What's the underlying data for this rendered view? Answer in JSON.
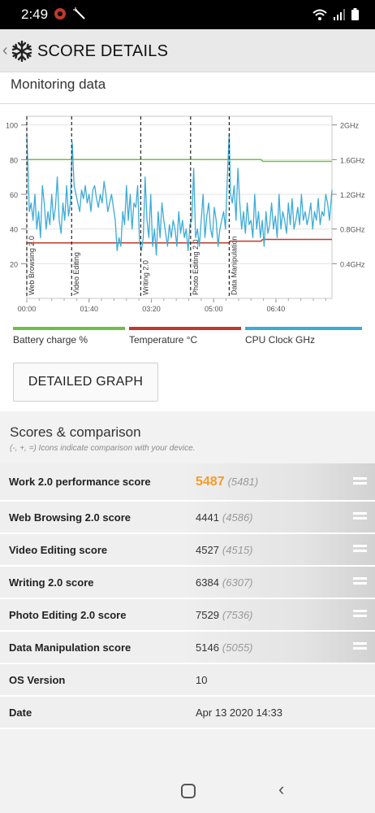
{
  "status": {
    "time": "2:49",
    "left_icons": [
      "red-app-icon",
      "magic-wand-icon"
    ],
    "right_icons": [
      "wifi-icon",
      "signal-icon",
      "battery-icon"
    ]
  },
  "app_bar": {
    "back_icon": "chevron-left-icon",
    "logo_icon": "snowflake-icon",
    "title": "SCORE DETAILS"
  },
  "monitoring": {
    "title": "Monitoring data",
    "detailed_graph_button": "DETAILED GRAPH"
  },
  "chart_data": {
    "type": "line",
    "x_tick_labels": [
      "00:00",
      "01:40",
      "03:20",
      "05:00",
      "06:40"
    ],
    "x_range_seconds": [
      0,
      490
    ],
    "y_left_ticks": [
      "20",
      "40",
      "60",
      "80",
      "100"
    ],
    "y_left_range": [
      0,
      105
    ],
    "y_right_ticks": [
      "0.4GHz",
      "0.8GHz",
      "1.2GHz",
      "1.6GHz",
      "2GHz"
    ],
    "grid": true,
    "section_markers": [
      {
        "label": "Web Browsing 2.0",
        "x": 0
      },
      {
        "label": "Video Editing",
        "x": 72
      },
      {
        "label": "Writing 2.0",
        "x": 183
      },
      {
        "label": "Photo Editing 2.0",
        "x": 263
      },
      {
        "label": "Data Manipulation",
        "x": 325
      }
    ],
    "series": [
      {
        "name": "Battery charge %",
        "color": "#6cc04a",
        "x": [
          0,
          376,
          379,
          490
        ],
        "y": [
          80,
          80,
          79,
          79
        ]
      },
      {
        "name": "Temperature °C",
        "color": "#c0392b",
        "x": [
          0,
          2,
          325,
          326,
          376,
          379,
          490
        ],
        "y": [
          32,
          32,
          32,
          33,
          33,
          34,
          34
        ]
      },
      {
        "name": "CPU Clock GHz",
        "color": "#3cabd8",
        "x": [
          0,
          2,
          4,
          7,
          10,
          13,
          16,
          19,
          22,
          25,
          28,
          31,
          34,
          37,
          40,
          43,
          46,
          49,
          52,
          55,
          58,
          61,
          64,
          67,
          70,
          73,
          76,
          79,
          82,
          85,
          88,
          91,
          94,
          97,
          100,
          103,
          106,
          109,
          112,
          115,
          118,
          121,
          124,
          127,
          130,
          133,
          136,
          139,
          142,
          145,
          148,
          151,
          154,
          157,
          160,
          163,
          166,
          169,
          172,
          175,
          178,
          181,
          184,
          187,
          190,
          193,
          196,
          199,
          202,
          205,
          208,
          211,
          214,
          217,
          220,
          223,
          226,
          229,
          232,
          235,
          238,
          241,
          244,
          247,
          250,
          253,
          256,
          259,
          262,
          265,
          268,
          271,
          274,
          277,
          280,
          283,
          286,
          289,
          292,
          295,
          298,
          301,
          304,
          307,
          310,
          313,
          316,
          319,
          322,
          325,
          327,
          330,
          333,
          336,
          339,
          342,
          345,
          348,
          351,
          354,
          357,
          360,
          363,
          366,
          369,
          372,
          375,
          378,
          381,
          384,
          387,
          390,
          393,
          396,
          399,
          402,
          405,
          408,
          411,
          414,
          417,
          420,
          423,
          426,
          429,
          432,
          435,
          438,
          441,
          444,
          447,
          450,
          453,
          456,
          459,
          462,
          465,
          468,
          471,
          474,
          477,
          480,
          483,
          486,
          490
        ],
        "y": [
          1.9,
          1.5,
          1.0,
          1.1,
          0.9,
          1.2,
          0.8,
          1.0,
          0.7,
          1.3,
          1.1,
          0.8,
          1.0,
          0.85,
          1.2,
          0.9,
          1.05,
          1.4,
          0.9,
          0.75,
          1.1,
          0.9,
          1.3,
          0.95,
          1.1,
          1.8,
          1.3,
          1.2,
          1.1,
          1.0,
          1.25,
          1.15,
          1.3,
          1.1,
          1.2,
          1.0,
          1.25,
          1.3,
          1.15,
          1.05,
          1.2,
          1.1,
          1.35,
          1.2,
          1.0,
          1.1,
          1.2,
          1.05,
          0.9,
          0.55,
          0.7,
          0.6,
          1.0,
          0.85,
          1.3,
          0.9,
          1.2,
          0.8,
          1.1,
          1.05,
          1.3,
          0.65,
          0.55,
          0.7,
          1.4,
          0.9,
          0.7,
          1.2,
          0.6,
          0.8,
          0.5,
          1.0,
          0.7,
          1.1,
          0.9,
          0.75,
          0.6,
          0.85,
          0.7,
          0.9,
          0.8,
          0.6,
          1.0,
          0.75,
          0.9,
          0.7,
          0.8,
          0.55,
          0.85,
          0.9,
          1.5,
          0.7,
          0.8,
          0.6,
          0.9,
          1.2,
          0.7,
          0.95,
          1.1,
          0.8,
          0.7,
          1.05,
          0.9,
          0.6,
          0.8,
          0.9,
          1.0,
          0.8,
          1.4,
          1.9,
          1.2,
          1.1,
          1.3,
          0.9,
          1.5,
          1.1,
          0.8,
          1.0,
          0.75,
          1.1,
          0.85,
          0.9,
          0.7,
          1.2,
          0.8,
          1.0,
          0.7,
          0.9,
          0.6,
          1.0,
          0.75,
          0.85,
          1.1,
          0.8,
          0.95,
          0.7,
          1.2,
          0.8,
          1.0,
          0.9,
          0.75,
          1.1,
          0.85,
          1.15,
          0.8,
          0.9,
          1.05,
          0.85,
          1.2,
          0.9,
          1.0,
          0.85,
          0.95,
          1.1,
          0.8,
          1.0,
          0.9,
          1.15,
          0.85,
          1.0,
          0.95,
          1.2,
          1.1,
          0.9,
          1.25
        ]
      }
    ]
  },
  "legend": [
    {
      "label": "Battery charge %",
      "color": "#6cc04a"
    },
    {
      "label": "Temperature °C",
      "color": "#c0392b"
    },
    {
      "label": "CPU Clock GHz",
      "color": "#3cabd8"
    }
  ],
  "scores": {
    "title": "Scores & comparison",
    "subtitle": "(-, +, =) Icons indicate comparison with your device.",
    "rows": [
      {
        "label": "Work 2.0 performance score",
        "value": "5487",
        "compare": "(5481)",
        "icon": "equal-icon"
      },
      {
        "label": "Web Browsing 2.0 score",
        "value": "4441",
        "compare": "(4586)",
        "icon": "equal-icon"
      },
      {
        "label": "Video Editing score",
        "value": "4527",
        "compare": "(4515)",
        "icon": "equal-icon"
      },
      {
        "label": "Writing 2.0 score",
        "value": "6384",
        "compare": "(6307)",
        "icon": "equal-icon"
      },
      {
        "label": "Photo Editing 2.0 score",
        "value": "7529",
        "compare": "(7536)",
        "icon": "equal-icon"
      },
      {
        "label": "Data Manipulation score",
        "value": "5146",
        "compare": "(5055)",
        "icon": "equal-icon"
      },
      {
        "label": "OS Version",
        "value": "10"
      },
      {
        "label": "Date",
        "value": "Apr 13 2020 14:33"
      }
    ]
  },
  "nav": {
    "home_icon": "home-icon",
    "back_icon": "back-icon"
  }
}
